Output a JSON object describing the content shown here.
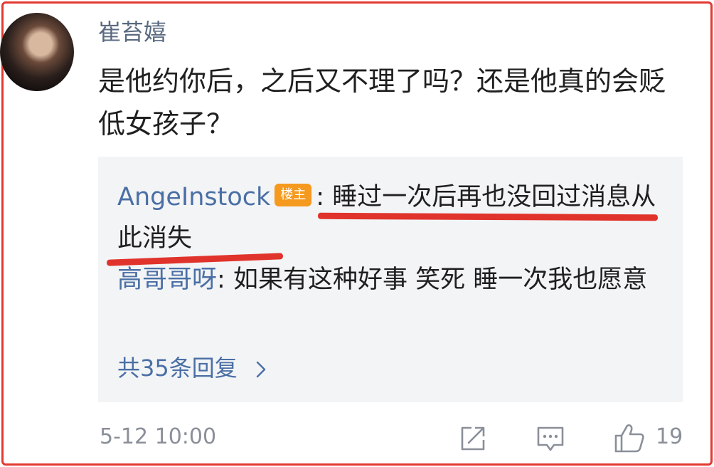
{
  "comment": {
    "username": "崔苔嬉",
    "text": "是他约你后，之后又不理了吗？还是他真的会贬低女孩子？",
    "time": "5-12 10:00",
    "like_count": "19"
  },
  "replies": [
    {
      "name": "AngeInstock",
      "badge": "楼主",
      "separator": ": ",
      "text": "睡过一次后再也没回过消息从此消失"
    },
    {
      "name": "高哥哥呀",
      "separator": ": ",
      "text": "如果有这种好事 笑死 睡一次我也愿意"
    }
  ],
  "more_replies": "共35条回复",
  "more_icon": "chevron-right-icon",
  "action_icons": [
    "share-icon",
    "comment-icon",
    "like-icon"
  ],
  "colors": {
    "highlight": "#e0332b",
    "link": "#4a6fa5",
    "badge": "#f59a1f"
  }
}
